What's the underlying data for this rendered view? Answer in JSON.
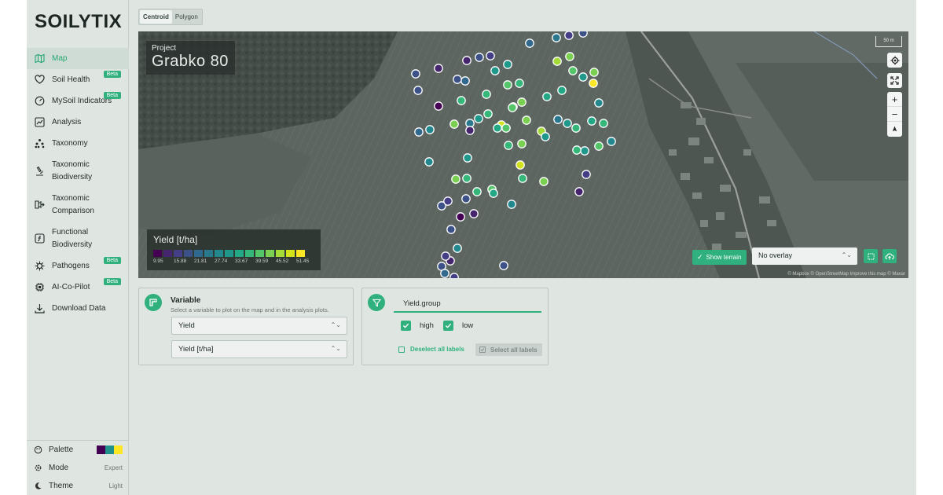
{
  "brand": "SOILYTIX",
  "nav": {
    "items": [
      {
        "label": "Map",
        "icon": "map-icon",
        "active": true,
        "badge": ""
      },
      {
        "label": "Soil Health",
        "icon": "heart-icon",
        "badge": "Beta"
      },
      {
        "label": "MySoil Indicators",
        "icon": "gauge-icon",
        "badge": "Beta"
      },
      {
        "label": "Analysis",
        "icon": "chart-line-icon",
        "badge": ""
      },
      {
        "label": "Taxonomy",
        "icon": "hierarchy-icon",
        "badge": ""
      },
      {
        "label": "Taxonomic Biodiversity",
        "label1": "Taxonomic",
        "label2": "Biodiversity",
        "icon": "microscope-icon",
        "badge": ""
      },
      {
        "label": "Taxonomic Comparison",
        "label1": "Taxonomic",
        "label2": "Comparison",
        "icon": "compare-icon",
        "badge": ""
      },
      {
        "label": "Functional Biodiversity",
        "label1": "Functional",
        "label2": "Biodiversity",
        "icon": "function-icon",
        "badge": ""
      },
      {
        "label": "Pathogens",
        "icon": "virus-icon",
        "badge": "Beta"
      },
      {
        "label": "AI-Co-Pilot",
        "icon": "chip-icon",
        "badge": "Beta"
      },
      {
        "label": "Download Data",
        "icon": "download-icon",
        "badge": ""
      }
    ]
  },
  "footer": {
    "palette_label": "Palette",
    "palette_colors": [
      "#440154",
      "#21918c",
      "#fde725"
    ],
    "mode_label": "Mode",
    "mode_value": "Expert",
    "theme_label": "Theme",
    "theme_value": "Light"
  },
  "mode_tabs": [
    "Centroid",
    "Polygon"
  ],
  "map": {
    "project_label": "Project",
    "project_name": "Grabko 80",
    "scale_label": "50 m",
    "legend_title": "Yield [t/ha]",
    "legend_ticks": [
      "9.95",
      "15.88",
      "21.81",
      "27.74",
      "33.67",
      "39.59",
      "45.52",
      "51.45"
    ],
    "legend_colors": [
      "#440154",
      "#46256f",
      "#433e85",
      "#3b5188",
      "#31688e",
      "#2a788e",
      "#23888e",
      "#1f988b",
      "#22a884",
      "#35b779",
      "#54c568",
      "#7ad151",
      "#a5db36",
      "#d2e21b",
      "#fde725"
    ],
    "show_terrain_label": "Show terrain",
    "overlay_value": "No overlay",
    "attribution": "© Mapbox © OpenStreetMap  Improve this map  © Maxar",
    "points": [
      {
        "yield": 22.0
      },
      {
        "yield": 24.0
      },
      {
        "yield": 16.0
      },
      {
        "yield": 20.0
      },
      {
        "yield": 13.0
      },
      {
        "yield": 18.0
      },
      {
        "yield": 15.0
      },
      {
        "yield": 21.0
      },
      {
        "yield": 45.0
      },
      {
        "yield": 42.0
      },
      {
        "yield": 18.0
      },
      {
        "yield": 14.0
      },
      {
        "yield": 20.0
      },
      {
        "yield": 32.0
      },
      {
        "yield": 30.0
      },
      {
        "yield": 38.0
      },
      {
        "yield": 44.0
      },
      {
        "yield": 30.0
      },
      {
        "yield": 40.0
      },
      {
        "yield": 53.0
      },
      {
        "yield": 20.0
      },
      {
        "yield": 11.0
      },
      {
        "yield": 36.0
      },
      {
        "yield": 38.0
      },
      {
        "yield": 40.0
      },
      {
        "yield": 44.0
      },
      {
        "yield": 46.0
      },
      {
        "yield": 34.0
      },
      {
        "yield": 35.0
      },
      {
        "yield": 28.0
      },
      {
        "yield": 22.0
      },
      {
        "yield": 28.0
      },
      {
        "yield": 42.0
      },
      {
        "yield": 48.0
      },
      {
        "yield": 40.0
      },
      {
        "yield": 36.0
      },
      {
        "yield": 30.0
      },
      {
        "yield": 40.0
      },
      {
        "yield": 26.0
      },
      {
        "yield": 35.0
      },
      {
        "yield": 42.0
      },
      {
        "yield": 14.0
      },
      {
        "yield": 46.0
      },
      {
        "yield": 24.0
      },
      {
        "yield": 32.0
      },
      {
        "yield": 35.0
      },
      {
        "yield": 38.0
      },
      {
        "yield": 36.0
      },
      {
        "yield": 42.0
      },
      {
        "yield": 30.0
      },
      {
        "yield": 40.0
      },
      {
        "yield": 28.0
      },
      {
        "yield": 32.0
      },
      {
        "yield": 38.0
      },
      {
        "yield": 37.0
      },
      {
        "yield": 28.0
      },
      {
        "yield": 30.0
      },
      {
        "yield": 48.0
      },
      {
        "yield": 38.0
      },
      {
        "yield": 36.0
      },
      {
        "yield": 40.0
      },
      {
        "yield": 35.0
      },
      {
        "yield": 38.0
      },
      {
        "yield": 42.0
      },
      {
        "yield": 20.0
      },
      {
        "yield": 28.0
      },
      {
        "yield": 16.0
      },
      {
        "yield": 44.0
      },
      {
        "yield": 15.0
      },
      {
        "yield": 12.0
      },
      {
        "yield": 18.0
      },
      {
        "yield": 14.0
      },
      {
        "yield": 10.0
      },
      {
        "yield": 20.0
      },
      {
        "yield": 28.0
      },
      {
        "yield": 12.0
      },
      {
        "yield": 15.0
      },
      {
        "yield": 20.0
      },
      {
        "yield": 16.0
      },
      {
        "yield": 18.0
      },
      {
        "yield": 22.0
      }
    ]
  },
  "variable_card": {
    "title": "Variable",
    "help": "Select a variable to plot on the map and in the analysis plots.",
    "variable_value": "Yield",
    "unit_value": "Yield [t/ha]"
  },
  "group_card": {
    "tab_label": "Yield.group",
    "options": [
      {
        "label": "high",
        "checked": true
      },
      {
        "label": "low",
        "checked": true
      }
    ],
    "deselect_label": "Deselect all labels",
    "select_label": "Select all labels"
  }
}
